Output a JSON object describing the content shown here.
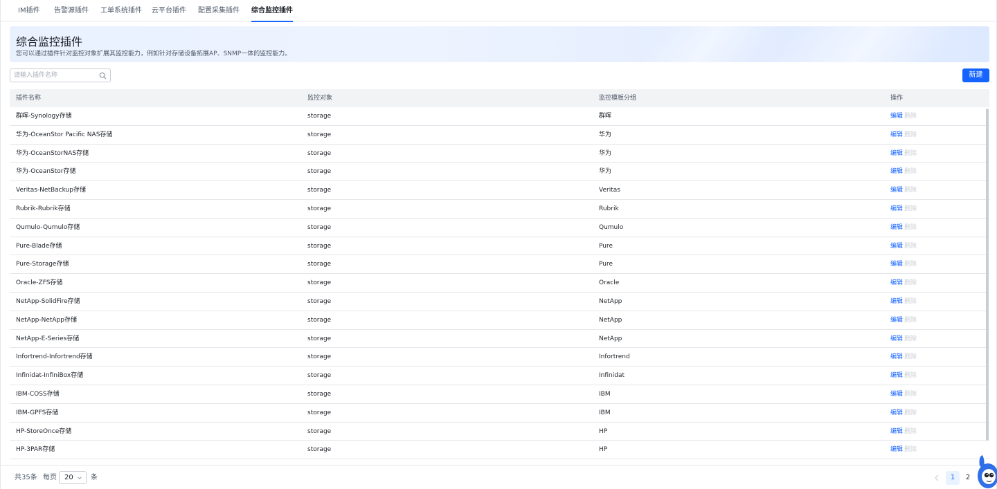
{
  "tabs": [
    {
      "label": "IM插件"
    },
    {
      "label": "告警源插件"
    },
    {
      "label": "工单系统插件"
    },
    {
      "label": "云平台插件"
    },
    {
      "label": "配置采集插件"
    },
    {
      "label": "综合监控插件"
    }
  ],
  "banner": {
    "title": "综合监控插件",
    "description": "您可以通过插件针对监控对象扩展其监控能力，例如针对存储设备拓展AP、SNMP一体的监控能力。"
  },
  "search": {
    "placeholder": "请输入插件名称",
    "value": ""
  },
  "toolbar": {
    "new_label": "新建"
  },
  "table": {
    "headers": {
      "name": "插件名称",
      "target": "监控对象",
      "group": "监控模板分组",
      "ops": "操作"
    },
    "edit_label": "编辑",
    "delete_label": "删除",
    "rows": [
      {
        "name": "群晖-Synology存储",
        "target": "storage",
        "group": "群晖"
      },
      {
        "name": "华为-OceanStor Pacific NAS存储",
        "target": "storage",
        "group": "华为"
      },
      {
        "name": "华为-OceanStorNAS存储",
        "target": "storage",
        "group": "华为"
      },
      {
        "name": "华为-OceanStor存储",
        "target": "storage",
        "group": "华为"
      },
      {
        "name": "Veritas-NetBackup存储",
        "target": "storage",
        "group": "Veritas"
      },
      {
        "name": "Rubrik-Rubrik存储",
        "target": "storage",
        "group": "Rubrik"
      },
      {
        "name": "Qumulo-Qumulo存储",
        "target": "storage",
        "group": "Qumulo"
      },
      {
        "name": "Pure-Blade存储",
        "target": "storage",
        "group": "Pure"
      },
      {
        "name": "Pure-Storage存储",
        "target": "storage",
        "group": "Pure"
      },
      {
        "name": "Oracle-ZFS存储",
        "target": "storage",
        "group": "Oracle"
      },
      {
        "name": "NetApp-SolidFire存储",
        "target": "storage",
        "group": "NetApp"
      },
      {
        "name": "NetApp-NetApp存储",
        "target": "storage",
        "group": "NetApp"
      },
      {
        "name": "NetApp-E-Series存储",
        "target": "storage",
        "group": "NetApp"
      },
      {
        "name": "Infortrend-Infortrend存储",
        "target": "storage",
        "group": "Infortrend"
      },
      {
        "name": "Infinidat-InfiniBox存储",
        "target": "storage",
        "group": "Infinidat"
      },
      {
        "name": "IBM-COSS存储",
        "target": "storage",
        "group": "IBM"
      },
      {
        "name": "IBM-GPFS存储",
        "target": "storage",
        "group": "IBM"
      },
      {
        "name": "HP-StoreOnce存储",
        "target": "storage",
        "group": "HP"
      },
      {
        "name": "HP-3PAR存储",
        "target": "storage",
        "group": "HP"
      }
    ]
  },
  "pagination": {
    "total_text": "共35条",
    "per_page_label": "每页",
    "page_size": "20",
    "unit_label": "条",
    "pages": [
      "1",
      "2"
    ],
    "current_page": "1"
  },
  "colors": {
    "primary": "#1664ff",
    "header_bg": "#f2f3f5",
    "border": "#e5e6eb",
    "disabled": "#c9cdd4"
  }
}
